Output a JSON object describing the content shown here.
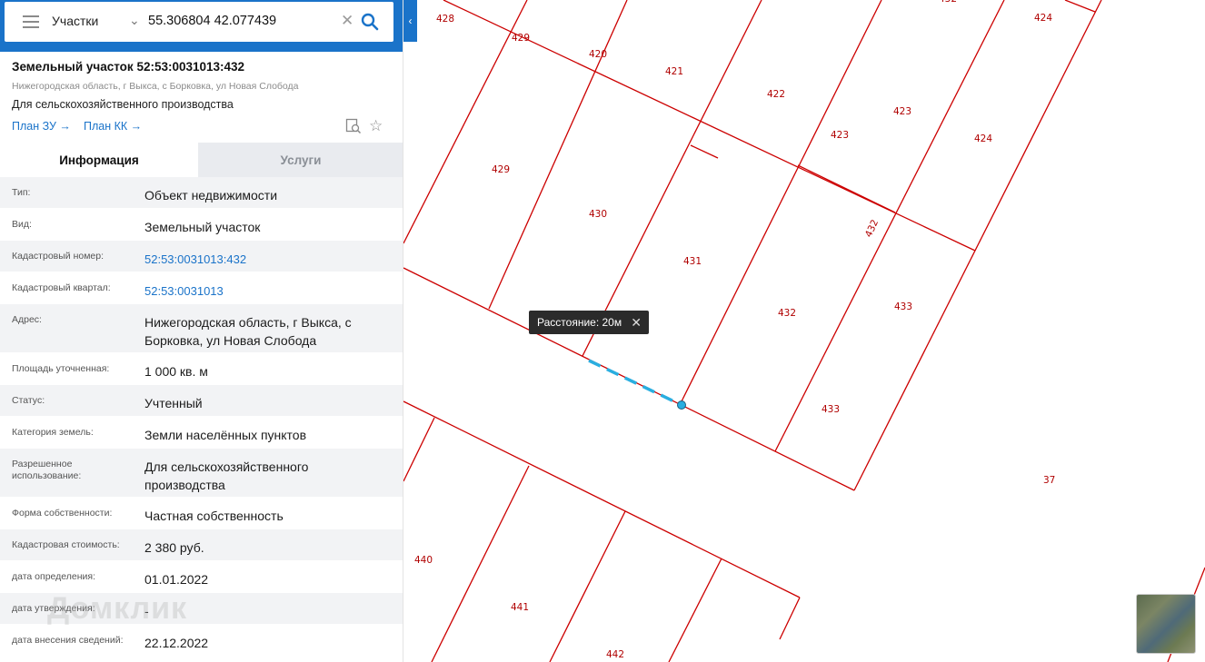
{
  "search": {
    "layer": "Участки",
    "query": "55.306804 42.077439"
  },
  "parcel": {
    "title": "Земельный участок 52:53:0031013:432",
    "address_small": "Нижегородская область, г Выкса, с Борковка, ул Новая Слобода",
    "purpose": "Для сельскохозяйственного производства",
    "plan_zu": "План ЗУ →",
    "plan_kk": "План КК →"
  },
  "tabs": {
    "info": "Информация",
    "services": "Услуги"
  },
  "details": [
    {
      "key": "Тип:",
      "value": "Объект недвижимости"
    },
    {
      "key": "Вид:",
      "value": "Земельный участок"
    },
    {
      "key": "Кадастровый номер:",
      "value": "52:53:0031013:432"
    },
    {
      "key": "Кадастровый квартал:",
      "value": "52:53:0031013"
    },
    {
      "key": "Адрес:",
      "value": "Нижегородская область, г Выкса, с Борковка, ул Новая Слобода"
    },
    {
      "key": "Площадь уточненная:",
      "value": "1 000 кв. м"
    },
    {
      "key": "Статус:",
      "value": "Учтенный"
    },
    {
      "key": "Категория земель:",
      "value": "Земли населённых пунктов"
    },
    {
      "key": "Разрешенное использование:",
      "value": "Для сельскохозяйственного производства"
    },
    {
      "key": "Форма собственности:",
      "value": "Частная собственность"
    },
    {
      "key": "Кадастровая стоимость:",
      "value": "2 380 руб."
    },
    {
      "key": "дата определения:",
      "value": "01.01.2022"
    },
    {
      "key": "дата утверждения:",
      "value": "-"
    },
    {
      "key": "дата внесения сведений:",
      "value": "22.12.2022"
    }
  ],
  "watermark": "Домклик",
  "map": {
    "distance_label": "Расстояние: 20м",
    "parcel_labels": [
      "428",
      "429",
      "420",
      "421",
      "422",
      "423",
      "424",
      "429",
      "430",
      "431",
      "432",
      "423",
      "424",
      "432",
      "433",
      "433",
      "432",
      "37",
      "440",
      "441",
      "442"
    ],
    "line_color": "#cc0000",
    "measure_color": "#2aaee0"
  }
}
